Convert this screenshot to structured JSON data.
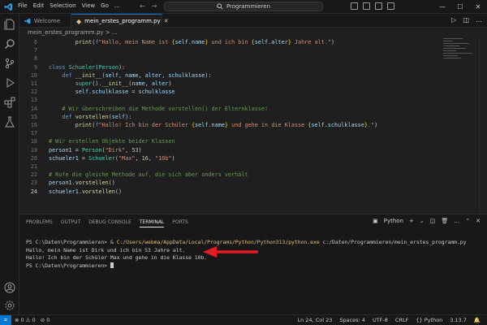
{
  "window": {
    "menu": [
      "File",
      "Edit",
      "Selection",
      "View",
      "Go",
      "..."
    ],
    "search_text": "Programmieren"
  },
  "tabs": [
    {
      "label": "Welcome",
      "active": false
    },
    {
      "label": "mein_erstes_programm.py",
      "active": true
    }
  ],
  "breadcrumb": "mein_erstes_programm.py > ...",
  "editor": {
    "lines": [
      {
        "n": "6",
        "html": "        <span class='f'>print</span>(<span class='k'>f</span><span class='s'>\"Hallo, mein Name ist </span><span class='p'>{</span><span class='v'>self</span>.<span class='v'>name</span><span class='p'>}</span><span class='s'> und ich bin </span><span class='p'>{</span><span class='v'>self</span>.<span class='v'>alter</span><span class='p'>}</span><span class='s'> Jahre alt.\"</span>)"
      },
      {
        "n": "7",
        "html": ""
      },
      {
        "n": "8",
        "html": ""
      },
      {
        "n": "9",
        "html": "<span class='k'>class</span> <span class='c'>Schueler</span>(<span class='c'>Person</span>):"
      },
      {
        "n": "10",
        "html": "    <span class='k'>def</span> <span class='f'>__init__</span>(<span class='v'>self</span>, <span class='v'>name</span>, <span class='v'>alter</span>, <span class='v'>schulklasse</span>):"
      },
      {
        "n": "11",
        "html": "        <span class='c'>super</span>().<span class='f'>__init__</span>(<span class='v'>name</span>, <span class='v'>alter</span>)"
      },
      {
        "n": "12",
        "html": "        <span class='v'>self</span>.<span class='v'>schulklasse</span> = <span class='v'>schulklasse</span>"
      },
      {
        "n": "13",
        "html": ""
      },
      {
        "n": "14",
        "html": "    <span class='cm'># Wir überschreiben die Methode vorstellen() der Elternklasse!</span>"
      },
      {
        "n": "15",
        "html": "    <span class='k'>def</span> <span class='f'>vorstellen</span>(<span class='v'>self</span>):"
      },
      {
        "n": "16",
        "html": "        <span class='f'>print</span>(<span class='k'>f</span><span class='s'>\"Hallo! Ich bin der Schüler </span><span class='p'>{</span><span class='v'>self</span>.<span class='v'>name</span><span class='p'>}</span><span class='s'> und gehe in die Klasse </span><span class='p'>{</span><span class='v'>self</span>.<span class='v'>schulklasse</span><span class='p'>}</span><span class='s'>.\"</span>)"
      },
      {
        "n": "17",
        "html": ""
      },
      {
        "n": "18",
        "html": "<span class='cm'># Wir erstellen Objekte beider Klassen</span>"
      },
      {
        "n": "19",
        "html": "<span class='v'>person1</span> = <span class='c'>Person</span>(<span class='s'>\"Dirk\"</span>, <span class='n'>53</span>)"
      },
      {
        "n": "20",
        "html": "<span class='v'>schueler1</span> = <span class='c'>Schueler</span>(<span class='s'>\"Max\"</span>, <span class='n'>16</span>, <span class='s'>\"10b\"</span>)"
      },
      {
        "n": "21",
        "html": ""
      },
      {
        "n": "22",
        "html": "<span class='cm'># Rufe die gleiche Methode auf, die sich aber anders verhält</span>"
      },
      {
        "n": "23",
        "html": "<span class='v'>person1</span>.<span class='f'>vorstellen</span>()"
      },
      {
        "n": "24",
        "html": "<span class='v'>schueler1</span>.<span class='f'>vorstellen</span>()",
        "current": true
      }
    ]
  },
  "panel": {
    "tabs": [
      "PROBLEMS",
      "OUTPUT",
      "DEBUG CONSOLE",
      "TERMINAL",
      "PORTS"
    ],
    "active_tab": "TERMINAL",
    "shell_label": "Python",
    "terminal": {
      "cmd_prompt": "PS C:\\Daten\\Programmieren> & ",
      "cmd_path": "C:/Users/webma/AppData/Local/Programs/Python/Python313/python.exe",
      "cmd_arg": " c:/Daten/Programmieren/mein_erstes_programm.py",
      "out1": "Hallo, mein Name ist Dirk und ich bin 53 Jahre alt.",
      "out2": "Hallo! Ich bin der Schüler Max und gehe in die Klasse 10b.",
      "prompt_end": "PS C:\\Daten\\Programmieren> "
    }
  },
  "statusbar": {
    "problems": "⊗ 0 ⚠ 0",
    "ports": "⊘ 0",
    "position": "Ln 24, Col 23",
    "spaces": "Spaces: 4",
    "encoding": "UTF-8",
    "eol": "CRLF",
    "language": "Python",
    "version": "3.13.7"
  },
  "colors": {
    "accent": "#0078d4",
    "arrow": "#e51c23"
  }
}
